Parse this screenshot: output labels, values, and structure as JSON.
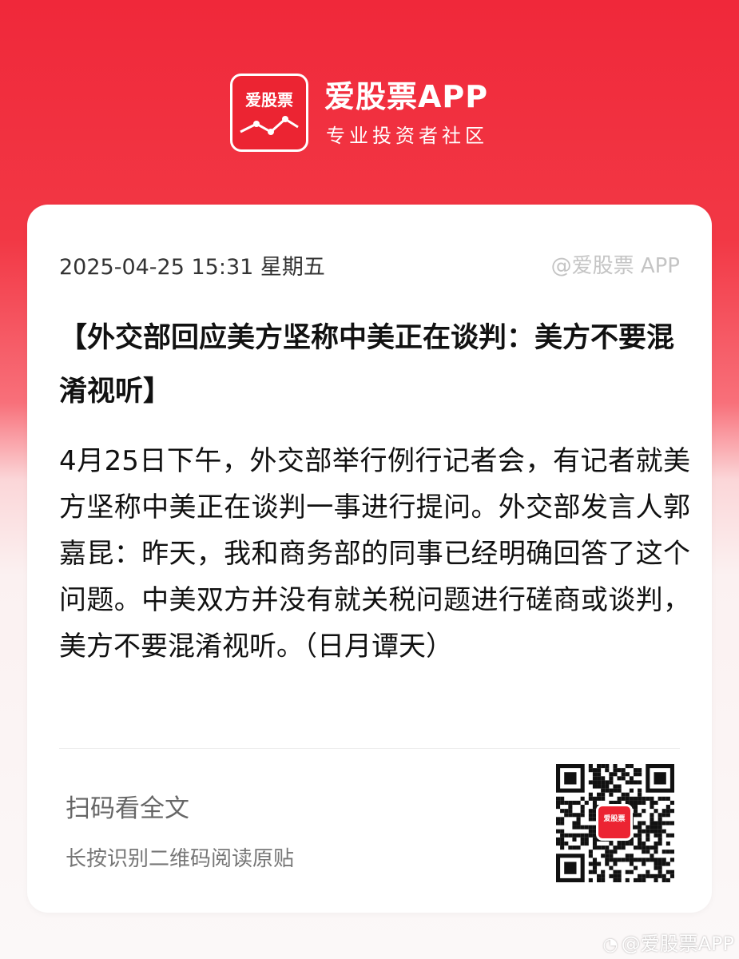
{
  "brand": {
    "logo_text": "爱股票",
    "name": "爱股票APP",
    "tagline": "专业投资者社区"
  },
  "card": {
    "datetime": "2025-04-25 15:31 星期五",
    "source": "@爱股票 APP",
    "title": "【外交部回应美方坚称中美正在谈判：美方不要混淆视听】",
    "body": "4月25日下午，外交部举行例行记者会，有记者就美方坚称中美正在谈判一事进行提问。外交部发言人郭嘉昆：昨天，我和商务部的同事已经明确回答了这个问题。中美双方并没有就关税问题进行磋商或谈判，美方不要混淆视听。（日月谭天）",
    "scan_title": "扫码看全文",
    "scan_hint": "长按识别二维码阅读原贴"
  },
  "qr_logo_text": "爱股票",
  "watermark": "@爱股票APP",
  "colors": {
    "brand_red": "#ec2432",
    "text_dark": "#111111",
    "text_muted": "#777777"
  },
  "icons": [
    "weibo-icon"
  ]
}
